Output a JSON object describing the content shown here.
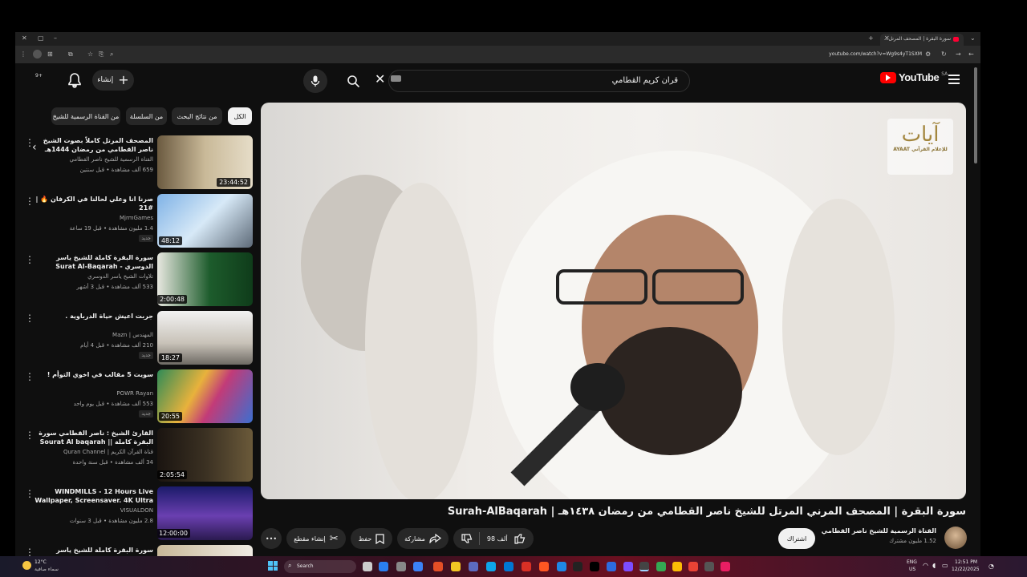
{
  "browser": {
    "tab_title": "سورة البقرة | المصحف المرتل...",
    "url": "youtube.com/watch?v=Wg9s4yT1SXM"
  },
  "youtube": {
    "logo_text": "YouTube",
    "region": "SA",
    "search_query": "قران كريم القطامي",
    "create_label": "إنشاء",
    "notif_badge": "9+"
  },
  "chips": [
    "الكل",
    "من نتائج البحث",
    "من السلسلة",
    "من القناة الرسمية للشيخ"
  ],
  "recommendations": [
    {
      "title": "المصحف المرتل كاملاً بصوت الشيخ ناصر القطامي من رمضان 1444هـ",
      "channel": "القناة الرسمية للشيخ ناصر القطامي",
      "meta": "659 ألف مشاهدة • قبل سنتين",
      "duration": "23:44:52",
      "badge": ""
    },
    {
      "title": "صرنا انا وعلي لحالنا في الكرفان 🔥 | #21",
      "channel": "MjrmGames",
      "meta": "1.4 مليون مشاهدة • قبل 19 ساعة",
      "duration": "48:12",
      "badge": "جديد"
    },
    {
      "title": "سورة البقرة كاملة للشيخ ياسر الدوسري - Surat Al-Baqarah",
      "channel": "تلاوات الشيخ ياسر الدوسري",
      "meta": "533 ألف مشاهدة • قبل 3 أشهر",
      "duration": "2:00:48",
      "badge": ""
    },
    {
      "title": "جربت اعيش حياة الدرباوية .",
      "channel": "المهندس | Mazn",
      "meta": "210 ألف مشاهدة • قبل 4 أيام",
      "duration": "18:27",
      "badge": "جديد"
    },
    {
      "title": "سويت 5 مقالب في اخوي التوأم !",
      "channel": "POWR Rayan",
      "meta": "553 ألف مشاهدة • قبل يوم واحد",
      "duration": "20:55",
      "badge": "جديد"
    },
    {
      "title": "القارئ الشيخ : ناصر القطامي سورة البقرة كاملة || Sourat Al baqarah",
      "channel": "قناة القرآن الكريم | Quran Channel",
      "meta": "34 ألف مشاهدة • قبل سنة واحدة",
      "duration": "2:05:54",
      "badge": ""
    },
    {
      "title": "WINDMILLS - 12 Hours Live Wallpaper, Screensaver. 4K Ultra",
      "channel": "VISUALDON",
      "meta": "2.8 مليون مشاهدة • قبل 3 سنوات",
      "duration": "12:00:00",
      "badge": ""
    },
    {
      "title": "سورة البقرة كاملة للشيخ ياسر الدوسري |",
      "channel": "",
      "meta": "",
      "duration": "",
      "badge": ""
    }
  ],
  "video": {
    "title": "سورة البقرة | المصحف المرني المرتل للشيخ ناصر القطامي من رمضان ١٤٣٨هـ | Surah-AlBaqarah",
    "watermark_title": "آيات",
    "watermark_sub": "AYAAT للإعلام القرآني",
    "channel_name": "القناة الرسمية للشيخ ناصر القطامي",
    "subscribers": "1.52 مليون مشترك",
    "subscribe_label": "اشتراك",
    "likes": "98 ألف",
    "share_label": "مشاركة",
    "save_label": "حفظ",
    "clip_label": "إنشاء مقطع"
  },
  "taskbar": {
    "weather_temp": "12°C",
    "weather_desc": "سماء صافية",
    "search_placeholder": "Search",
    "lang": "ENG",
    "region": "US",
    "time": "12:51 PM",
    "date": "12/22/2025"
  },
  "colors": {
    "yt_red": "#ff0000",
    "bg": "#0f0f0f",
    "chip": "#272727"
  }
}
